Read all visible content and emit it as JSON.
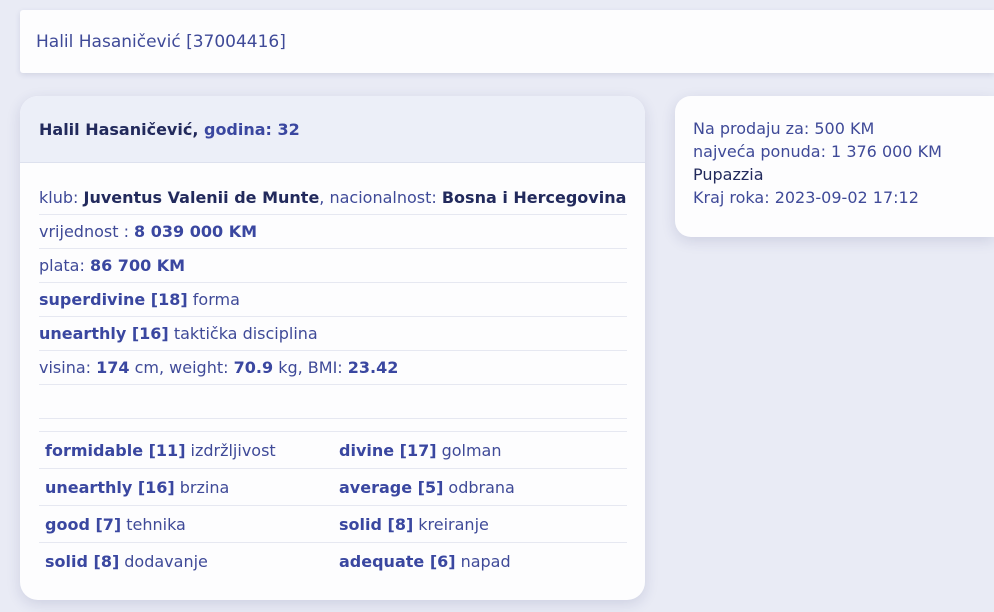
{
  "topbar": {
    "title": "Halil Hasaničević [37004416]"
  },
  "player": {
    "name": "Halil Hasaničević",
    "age_label": "godina:",
    "age": "32"
  },
  "details": {
    "club_label": "klub:",
    "club": "Juventus Valenii de Munte",
    "nationality_label": "nacionalnost:",
    "nationality": "Bosna i Hercegovina",
    "value_label": "vrijednost :",
    "value": "8 039 000 KM",
    "salary_label": "plata:",
    "salary": "86 700 KM",
    "form_level": "superdivine [18]",
    "form_label": "forma",
    "discipline_level": "unearthly [16]",
    "discipline_label": "taktička disciplina",
    "height_label": "visina:",
    "height": "174",
    "height_unit": "cm, weight:",
    "weight": "70.9",
    "weight_unit": "kg, BMI:",
    "bmi": "23.42"
  },
  "skills": [
    {
      "left_level": "formidable [11]",
      "left_name": "izdržljivost",
      "right_level": "divine [17]",
      "right_name": "golman"
    },
    {
      "left_level": "unearthly [16]",
      "left_name": "brzina",
      "right_level": "average [5]",
      "right_name": "odbrana"
    },
    {
      "left_level": "good [7]",
      "left_name": "tehnika",
      "right_level": "solid [8]",
      "right_name": "kreiranje"
    },
    {
      "left_level": "solid [8]",
      "left_name": "dodavanje",
      "right_level": "adequate [6]",
      "right_name": "napad"
    }
  ],
  "sale": {
    "price": "Na prodaju za: 500 KM",
    "best_offer": "najveća ponuda: 1 376 000 KM",
    "bidder": "Pupazzia",
    "deadline": "Kraj roka: 2023-09-02 17:12"
  }
}
